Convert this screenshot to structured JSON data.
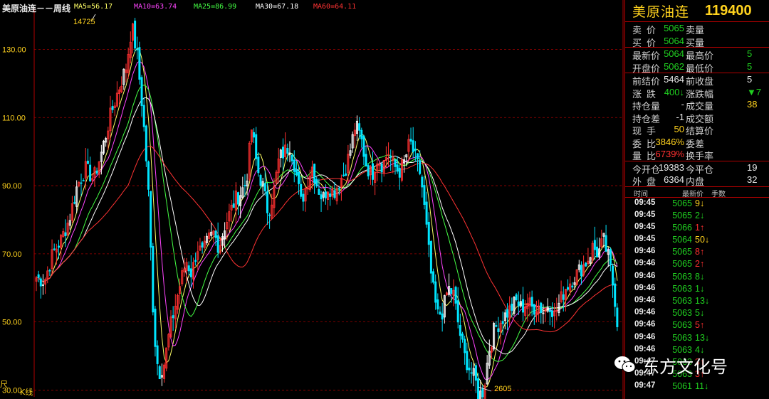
{
  "window": {
    "symbol_title": "美原油连－－周线",
    "ma_labels": [
      {
        "text": "MA5=56.17",
        "color": "#ffff66"
      },
      {
        "text": "MA10=63.74",
        "color": "#ff44ff"
      },
      {
        "text": "MA25=86.99",
        "color": "#44ff44"
      },
      {
        "text": "MA30=67.18",
        "color": "#ffffff"
      },
      {
        "text": "MA60=64.11",
        "color": "#ff3333"
      }
    ],
    "kline_label": "K线",
    "left_edge_label": "尺"
  },
  "chart_data": {
    "type": "candlestick",
    "title": "",
    "ylim": [
      28,
      142
    ],
    "yticks": [
      {
        "label": "130.00",
        "value": 130
      },
      {
        "label": "110.00",
        "value": 110
      },
      {
        "label": "90.00",
        "value": 90
      },
      {
        "label": "70.00",
        "value": 70
      },
      {
        "label": "50.00",
        "value": 50
      },
      {
        "label": "30.00",
        "value": 30
      }
    ],
    "grid": true,
    "high_marker": {
      "label": "14725",
      "value": 147.25
    },
    "low_marker": {
      "label": "2605",
      "value": 26.05
    },
    "price_path": [
      [
        0,
        63
      ],
      [
        3,
        62
      ],
      [
        6,
        70
      ],
      [
        9,
        74
      ],
      [
        12,
        80
      ],
      [
        15,
        90
      ],
      [
        18,
        95
      ],
      [
        21,
        92
      ],
      [
        24,
        100
      ],
      [
        27,
        110
      ],
      [
        30,
        118
      ],
      [
        33,
        125
      ],
      [
        35,
        137
      ],
      [
        37,
        128
      ],
      [
        39,
        112
      ],
      [
        41,
        90
      ],
      [
        42,
        70
      ],
      [
        43,
        50
      ],
      [
        44,
        40
      ],
      [
        45,
        35
      ],
      [
        47,
        38
      ],
      [
        49,
        48
      ],
      [
        51,
        55
      ],
      [
        53,
        62
      ],
      [
        55,
        68
      ],
      [
        57,
        64
      ],
      [
        59,
        72
      ],
      [
        61,
        70
      ],
      [
        63,
        74
      ],
      [
        65,
        76
      ],
      [
        67,
        72
      ],
      [
        69,
        78
      ],
      [
        71,
        82
      ],
      [
        73,
        86
      ],
      [
        75,
        88
      ],
      [
        77,
        91
      ],
      [
        79,
        107
      ],
      [
        81,
        95
      ],
      [
        83,
        90
      ],
      [
        85,
        82
      ],
      [
        87,
        88
      ],
      [
        89,
        98
      ],
      [
        91,
        100
      ],
      [
        93,
        102
      ],
      [
        95,
        95
      ],
      [
        97,
        85
      ],
      [
        99,
        90
      ],
      [
        101,
        96
      ],
      [
        103,
        90
      ],
      [
        105,
        86
      ],
      [
        107,
        90
      ],
      [
        109,
        88
      ],
      [
        111,
        91
      ],
      [
        113,
        94
      ],
      [
        115,
        100
      ],
      [
        117,
        108
      ],
      [
        119,
        104
      ],
      [
        121,
        96
      ],
      [
        123,
        93
      ],
      [
        125,
        98
      ],
      [
        127,
        96
      ],
      [
        129,
        100
      ],
      [
        131,
        96
      ],
      [
        133,
        94
      ],
      [
        135,
        97
      ],
      [
        137,
        103
      ],
      [
        139,
        98
      ],
      [
        141,
        93
      ],
      [
        143,
        78
      ],
      [
        145,
        62
      ],
      [
        147,
        52
      ],
      [
        149,
        53
      ],
      [
        151,
        60
      ],
      [
        153,
        58
      ],
      [
        155,
        48
      ],
      [
        157,
        40
      ],
      [
        159,
        36
      ],
      [
        161,
        33
      ],
      [
        162,
        28
      ],
      [
        164,
        30
      ],
      [
        166,
        42
      ],
      [
        168,
        48
      ],
      [
        170,
        50
      ],
      [
        172,
        52
      ],
      [
        174,
        54
      ],
      [
        176,
        56
      ],
      [
        178,
        54
      ],
      [
        180,
        56
      ],
      [
        182,
        54
      ],
      [
        184,
        55
      ],
      [
        186,
        53
      ],
      [
        188,
        56
      ],
      [
        190,
        52
      ],
      [
        192,
        56
      ],
      [
        194,
        60
      ],
      [
        196,
        62
      ],
      [
        198,
        64
      ],
      [
        200,
        66
      ],
      [
        202,
        68
      ],
      [
        204,
        72
      ],
      [
        206,
        70
      ],
      [
        208,
        74
      ],
      [
        210,
        68
      ],
      [
        212,
        58
      ],
      [
        213,
        50
      ]
    ],
    "moving_averages": [
      {
        "name": "MA5",
        "color": "#ffff66",
        "lag": 2
      },
      {
        "name": "MA10",
        "color": "#ff44ff",
        "lag": 4
      },
      {
        "name": "MA25",
        "color": "#44ff44",
        "lag": 8
      },
      {
        "name": "MA30",
        "color": "#ffffff",
        "lag": 10
      },
      {
        "name": "MA60",
        "color": "#ff3333",
        "lag": 20
      }
    ]
  },
  "panel": {
    "name": "美原油连",
    "code": "119400",
    "quote_rows": [
      {
        "l": "卖价",
        "v": "5065",
        "vc": "c-green",
        "r": "卖量",
        "rv": "",
        "rc": "c-green",
        "sep": false
      },
      {
        "l": "买价",
        "v": "5064",
        "vc": "c-green",
        "r": "买量",
        "rv": "",
        "rc": "c-green",
        "sep": true
      },
      {
        "l": "最新价",
        "v": "5064",
        "vc": "c-green",
        "r": "最高价",
        "rv": "5",
        "rc": "c-green",
        "sep": false
      },
      {
        "l": "开盘价",
        "v": "5062",
        "vc": "c-green",
        "r": "最低价",
        "rv": "5",
        "rc": "c-green",
        "sep": true
      },
      {
        "l": "前结价",
        "v": "5464",
        "vc": "c-white",
        "r": "前收盘",
        "rv": "5",
        "rc": "c-white",
        "sep": false
      },
      {
        "l": "涨跌",
        "v": "400↓",
        "vc": "c-green",
        "r": "涨跌幅",
        "rv": "▼7",
        "rc": "c-green",
        "sep": false
      },
      {
        "l": "持仓量",
        "v": "-",
        "vc": "c-white",
        "r": "成交量",
        "rv": "38",
        "rc": "c-yellow",
        "sep": false
      },
      {
        "l": "持仓差",
        "v": "-1",
        "vc": "c-white",
        "r": "成交额",
        "rv": "",
        "rc": "c-white",
        "sep": false
      },
      {
        "l": "现手",
        "v": "50",
        "vc": "c-yellow",
        "r": "结算价",
        "rv": "",
        "rc": "c-white",
        "sep": false
      },
      {
        "l": "委比",
        "v": "3846%",
        "vc": "c-yellow",
        "r": "委差",
        "rv": "",
        "rc": "c-white",
        "sep": false
      },
      {
        "l": "量比",
        "v": "6739%",
        "vc": "c-red",
        "r": "换手率",
        "rv": "",
        "rc": "c-white",
        "sep": true
      },
      {
        "l": "今开仓",
        "v": "19383",
        "vc": "c-white",
        "r": "今平仓",
        "rv": "19",
        "rc": "c-white",
        "sep": false
      },
      {
        "l": "外盘",
        "v": "6364",
        "vc": "c-white",
        "r": "内盘",
        "rv": "32",
        "rc": "c-white",
        "sep": true
      }
    ],
    "tick_header": {
      "time": "时间",
      "price": "最新价",
      "vol": "手数"
    },
    "ticks": [
      {
        "time": "09:45",
        "price": "5065",
        "vol": "9↓",
        "vc": "c-yellow"
      },
      {
        "time": "09:45",
        "price": "5065",
        "vol": "2↓",
        "vc": "c-green"
      },
      {
        "time": "09:45",
        "price": "5066",
        "vol": "1↑",
        "vc": "c-red"
      },
      {
        "time": "09:45",
        "price": "5064",
        "vol": "50↓",
        "vc": "c-yellow"
      },
      {
        "time": "09:46",
        "price": "5065",
        "vol": "8↑",
        "vc": "c-red"
      },
      {
        "time": "09:46",
        "price": "5065",
        "vol": "2↑",
        "vc": "c-red"
      },
      {
        "time": "09:46",
        "price": "5063",
        "vol": "8↓",
        "vc": "c-green"
      },
      {
        "time": "09:46",
        "price": "5063",
        "vol": "1↓",
        "vc": "c-green"
      },
      {
        "time": "09:46",
        "price": "5063",
        "vol": "13↓",
        "vc": "c-green"
      },
      {
        "time": "09:46",
        "price": "5063",
        "vol": "5↓",
        "vc": "c-green"
      },
      {
        "time": "09:46",
        "price": "5063",
        "vol": "5↑",
        "vc": "c-red"
      },
      {
        "time": "09:46",
        "price": "5063",
        "vol": "13↓",
        "vc": "c-green"
      },
      {
        "time": "09:46",
        "price": "5063",
        "vol": "4↓",
        "vc": "c-green"
      },
      {
        "time": "09:47",
        "price": "5063",
        "vol": "3↑",
        "vc": "c-red"
      },
      {
        "time": "09:47",
        "price": "5063",
        "vol": "3↑",
        "vc": "c-red"
      },
      {
        "time": "09:47",
        "price": "5061",
        "vol": "11↓",
        "vc": "c-green"
      }
    ]
  },
  "watermark": {
    "text": "东方文化号",
    "icon": "wechat-icon"
  }
}
